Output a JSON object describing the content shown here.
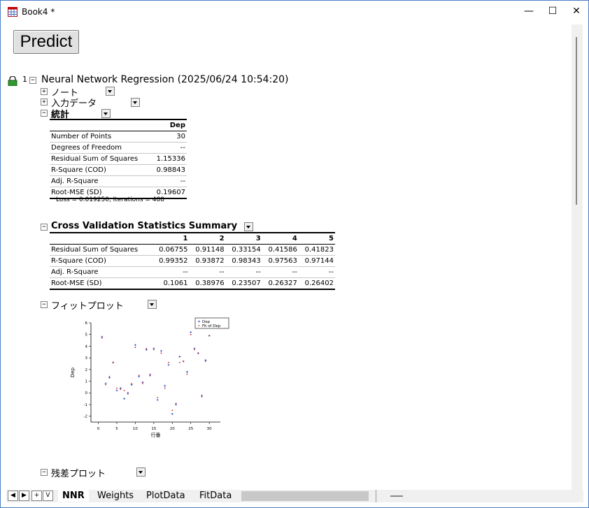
{
  "window": {
    "title": "Book4 *",
    "minimize": "—",
    "maximize": "☐",
    "close": "✕"
  },
  "predict_button": "Predict",
  "report": {
    "row_number": "1",
    "heading": "Neural Network Regression (2025/06/24 10:54:20)",
    "nodes": {
      "notes": "ノート",
      "input_data": "入力データ",
      "stats": "統計",
      "cv": "Cross Validation Statistics Summary",
      "fit_plot": "フィットプロット",
      "resid_plot": "残差プロット"
    },
    "stats_table": {
      "header": "Dep",
      "rows": [
        {
          "label": "Number of Points",
          "value": "30"
        },
        {
          "label": "Degrees of Freedom",
          "value": "--"
        },
        {
          "label": "Residual Sum of Squares",
          "value": "1.15336"
        },
        {
          "label": "R-Square (COD)",
          "value": "0.98843"
        },
        {
          "label": "Adj. R-Square",
          "value": "--"
        },
        {
          "label": "Root-MSE (SD)",
          "value": "0.19607"
        }
      ],
      "note": "Loss = 0.019250, Iterations = 488"
    },
    "cv_table": {
      "headers": [
        "1",
        "2",
        "3",
        "4",
        "5"
      ],
      "rows": [
        {
          "label": "Residual Sum of Squares",
          "values": [
            "0.06755",
            "0.91148",
            "0.33154",
            "0.41586",
            "0.41823"
          ]
        },
        {
          "label": "R-Square (COD)",
          "values": [
            "0.99352",
            "0.93872",
            "0.98343",
            "0.97563",
            "0.97144"
          ]
        },
        {
          "label": "Adj. R-Square",
          "values": [
            "--",
            "--",
            "--",
            "--",
            "--"
          ]
        },
        {
          "label": "Root-MSE (SD)",
          "values": [
            "0.1061",
            "0.38976",
            "0.23507",
            "0.26327",
            "0.26402"
          ]
        }
      ]
    }
  },
  "chart_data": {
    "type": "scatter",
    "xlabel": "行番",
    "ylabel": "Dep",
    "xlim": [
      -2,
      33
    ],
    "ylim": [
      -2.5,
      6
    ],
    "xticks": [
      "0",
      "5",
      "10",
      "15",
      "20",
      "25",
      "30"
    ],
    "yticks": [
      "-2",
      "-1",
      "0",
      "1",
      "2",
      "3",
      "4",
      "5",
      "6"
    ],
    "legend_position": "top-right",
    "series": [
      {
        "name": "Dep",
        "color": "#1f3fbf",
        "x": [
          1,
          2,
          3,
          4,
          5,
          6,
          7,
          8,
          9,
          10,
          11,
          12,
          13,
          14,
          15,
          16,
          17,
          18,
          19,
          20,
          21,
          22,
          23,
          24,
          25,
          26,
          27,
          28,
          29,
          30
        ],
        "y": [
          4.8,
          0.8,
          1.3,
          2.6,
          0.2,
          0.4,
          -0.5,
          0.0,
          0.7,
          4.1,
          1.4,
          0.9,
          3.7,
          1.5,
          3.8,
          -0.6,
          3.6,
          0.6,
          2.4,
          -1.8,
          -1.0,
          3.1,
          2.7,
          1.8,
          5.2,
          3.8,
          3.4,
          -0.3,
          2.8,
          4.9
        ]
      },
      {
        "name": "Fit of Dep",
        "color": "#d42020",
        "x": [
          1,
          2,
          3,
          4,
          5,
          6,
          7,
          8,
          9,
          10,
          11,
          12,
          13,
          14,
          15,
          16,
          17,
          18,
          19,
          20,
          21,
          22,
          23,
          24,
          25,
          26,
          27,
          28,
          29,
          30
        ],
        "y": [
          4.7,
          0.7,
          1.4,
          2.6,
          0.4,
          0.3,
          0.2,
          -0.1,
          0.8,
          3.9,
          1.5,
          0.8,
          3.8,
          1.6,
          3.7,
          -0.4,
          3.4,
          0.4,
          2.6,
          -1.5,
          -0.9,
          2.6,
          2.7,
          1.6,
          5.0,
          3.7,
          3.4,
          -0.2,
          2.7,
          4.9
        ]
      }
    ]
  },
  "tabs": [
    "NNR",
    "Weights",
    "PlotData",
    "FitData"
  ],
  "nav": {
    "first": "◀",
    "next": "▶",
    "add": "+",
    "menu": "V"
  },
  "colors": {
    "accent": "#4a7fc5",
    "dep": "#1f3fbf",
    "fit": "#d42020"
  }
}
